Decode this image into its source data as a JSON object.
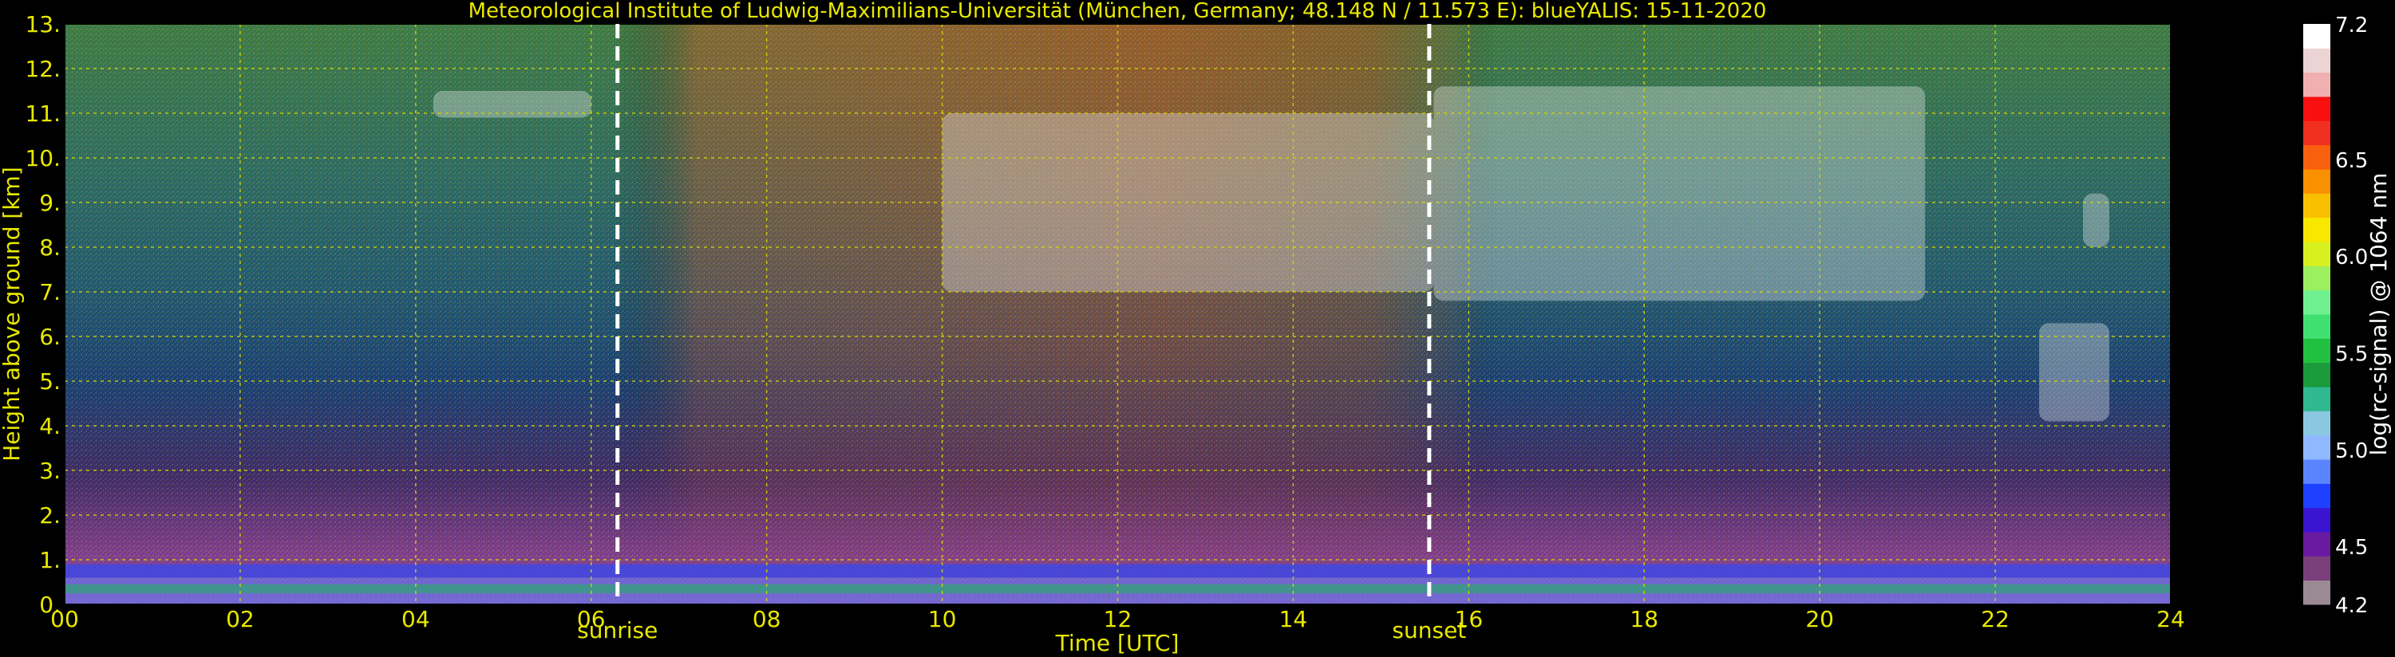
{
  "colors": {
    "background": "#000000",
    "text_axes": "#e8e800",
    "grid": "#d8d800",
    "markers": "#ffffff",
    "colorbar_text": "#ffffff"
  },
  "chart_data": {
    "type": "heatmap",
    "title": "Meteorological Institute of Ludwig-Maximilians-Universität (München, Germany; 48.148 N / 11.573 E):    blueYALIS: 15-11-2020",
    "xlabel": "Time [UTC]",
    "ylabel": "Height above ground [km]",
    "xlim": [
      0,
      24
    ],
    "ylim": [
      0,
      13
    ],
    "x_ticks": [
      "00",
      "02",
      "04",
      "06",
      "08",
      "10",
      "12",
      "14",
      "16",
      "18",
      "20",
      "22",
      "24"
    ],
    "y_ticks": [
      "0.",
      "1.",
      "2.",
      "3.",
      "4.",
      "5.",
      "6.",
      "7.",
      "8.",
      "9.",
      "10.",
      "11.",
      "12.",
      "13."
    ],
    "grid": true,
    "annotations": [
      {
        "label": "sunrise",
        "x": 6.3
      },
      {
        "label": "sunset",
        "x": 15.55
      }
    ],
    "colorbar": {
      "label": "log(rc-signal) @ 1064 nm",
      "range": [
        4.2,
        7.2
      ],
      "tick_labels": [
        "4.2",
        "4.5",
        "5.0",
        "5.5",
        "6.0",
        "6.5",
        "7.2"
      ],
      "tick_values": [
        4.2,
        4.5,
        5.0,
        5.5,
        6.0,
        6.5,
        7.2
      ],
      "colors": [
        "#9a8a94",
        "#7a3f7a",
        "#6a1aa0",
        "#3a14d0",
        "#1e40ff",
        "#5a84ff",
        "#90b8ff",
        "#8ac8e0",
        "#30b890",
        "#1a9a3a",
        "#22c040",
        "#40e070",
        "#70f090",
        "#9cf060",
        "#d8f020",
        "#f8e800",
        "#f8c000",
        "#f89000",
        "#f86010",
        "#f03020",
        "#f81010",
        "#f0b0b0",
        "#ecd4d4",
        "#ffffff"
      ]
    },
    "features": [
      {
        "name": "boundary layer",
        "x": [
          0,
          24
        ],
        "height_km": [
          0.0,
          0.9
        ]
      },
      {
        "name": "cirrus",
        "x": [
          4.2,
          6.0
        ],
        "height_km": [
          10.9,
          11.5
        ]
      },
      {
        "name": "cirrus",
        "x": [
          10.0,
          15.6
        ],
        "height_km": [
          7.0,
          11.0
        ]
      },
      {
        "name": "cirrus",
        "x": [
          15.6,
          21.2
        ],
        "height_km": [
          6.8,
          11.6
        ]
      },
      {
        "name": "cirrus",
        "x": [
          22.5,
          23.3
        ],
        "height_km": [
          4.1,
          6.3
        ]
      },
      {
        "name": "cirrus",
        "x": [
          23.0,
          23.3
        ],
        "height_km": [
          8.0,
          9.2
        ]
      }
    ]
  }
}
